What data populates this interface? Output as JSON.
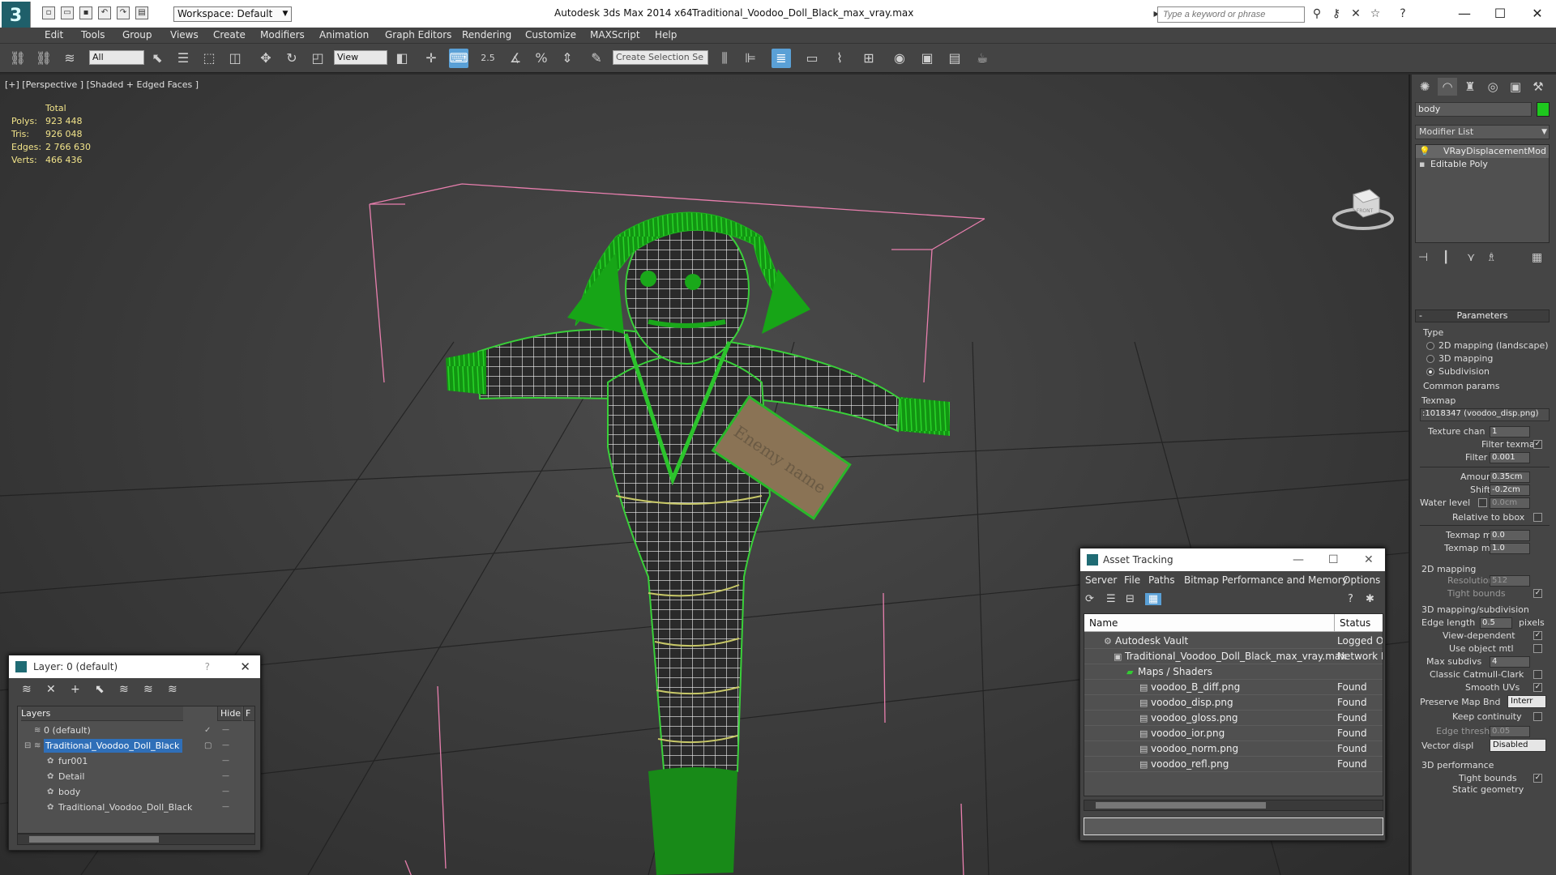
{
  "titlebar": {
    "workspace": "Workspace: Default",
    "app_title": "Autodesk 3ds Max  2014 x64",
    "doc_title": "Traditional_Voodoo_Doll_Black_max_vray.max",
    "search_placeholder": "Type a keyword or phrase"
  },
  "menu": [
    "Edit",
    "Tools",
    "Group",
    "Views",
    "Create",
    "Modifiers",
    "Animation",
    "Graph Editors",
    "Rendering",
    "Customize",
    "MAXScript",
    "Help"
  ],
  "toolbar": {
    "filter": "All",
    "ref_coord": "View",
    "snap_angle": "2.5",
    "selection_set_placeholder": "Create Selection Se"
  },
  "viewport": {
    "label": "[+] [Perspective ] [Shaded + Edged Faces ]",
    "stats": {
      "header": "Total",
      "polys_label": "Polys:",
      "polys": "923 448",
      "tris_label": "Tris:",
      "tris": "926 048",
      "edges_label": "Edges:",
      "edges": "2 766 630",
      "verts_label": "Verts:",
      "verts": "466 436"
    },
    "tag_text": "Enemy name",
    "viewcube_label": "FRONT"
  },
  "command_panel": {
    "object_name": "body",
    "object_color": "#1ec81e",
    "modifier_list": "Modifier List",
    "stack": [
      "VRayDisplacementMod",
      "Editable Poly"
    ],
    "rollout_parameters": "Parameters",
    "type_label": "Type",
    "type_options": [
      "2D mapping (landscape)",
      "3D mapping",
      "Subdivision"
    ],
    "common_params": "Common params",
    "texmap_label": "Texmap",
    "texmap_value": ":1018347 (voodoo_disp.png)",
    "texture_chan_label": "Texture chan",
    "texture_chan": "1",
    "filter_texmap_label": "Filter texmap",
    "filter_blur_label": "Filter blur",
    "filter_blur": "0.001",
    "amount_label": "Amount",
    "amount": "0.35cm",
    "shift_label": "Shift",
    "shift": "-0.2cm",
    "water_level_label": "Water level",
    "water_level": "0.0cm",
    "relative_bbox_label": "Relative to bbox",
    "texmap_min_label": "Texmap min",
    "texmap_min": "0.0",
    "texmap_max_label": "Texmap max",
    "texmap_max": "1.0",
    "mapping2d": "2D mapping",
    "resolution_label": "Resolution",
    "resolution": "512",
    "tight_bounds_label": "Tight bounds",
    "mapping3d": "3D mapping/subdivision",
    "edge_length_label": "Edge length",
    "edge_length": "0.5",
    "pixels_label": "pixels",
    "view_dependent_label": "View-dependent",
    "use_object_mtl_label": "Use object mtl",
    "max_subdivs_label": "Max subdivs",
    "max_subdivs": "4",
    "classic_cc_label": "Classic Catmull-Clark",
    "smooth_uvs_label": "Smooth UVs",
    "preserve_map_label": "Preserve Map Bnd",
    "preserve_map": "Interr",
    "keep_continuity_label": "Keep continuity",
    "edge_thresh_label": "Edge thresh",
    "edge_thresh": "0.05",
    "vector_disp_label": "Vector displ",
    "vector_disp": "Disabled",
    "perf_label": "3D performance",
    "tight_bounds2_label": "Tight bounds",
    "static_geometry_label": "Static geometry"
  },
  "layer_dialog": {
    "title": "Layer: 0 (default)",
    "help": "?",
    "col_layers": "Layers",
    "col_hide": "Hide",
    "col_f": "F",
    "rows": [
      {
        "name": "0 (default)",
        "indent": 0
      },
      {
        "name": "Traditional_Voodoo_Doll_Black",
        "indent": 0
      },
      {
        "name": "fur001",
        "indent": 1
      },
      {
        "name": "Detail",
        "indent": 1
      },
      {
        "name": "body",
        "indent": 1
      },
      {
        "name": "Traditional_Voodoo_Doll_Black",
        "indent": 1
      }
    ]
  },
  "asset_dialog": {
    "title": "Asset Tracking",
    "menu": [
      "Server",
      "File",
      "Paths",
      "Bitmap Performance and Memory",
      "Options"
    ],
    "col_name": "Name",
    "col_status": "Status",
    "rows": [
      {
        "name": "Autodesk Vault",
        "status": "Logged Out"
      },
      {
        "name": "Traditional_Voodoo_Doll_Black_max_vray.max",
        "status": "Network Path"
      },
      {
        "name": "Maps / Shaders",
        "status": ""
      },
      {
        "name": "voodoo_B_diff.png",
        "status": "Found"
      },
      {
        "name": "voodoo_disp.png",
        "status": "Found"
      },
      {
        "name": "voodoo_gloss.png",
        "status": "Found"
      },
      {
        "name": "voodoo_ior.png",
        "status": "Found"
      },
      {
        "name": "voodoo_norm.png",
        "status": "Found"
      },
      {
        "name": "voodoo_refl.png",
        "status": "Found"
      }
    ]
  }
}
